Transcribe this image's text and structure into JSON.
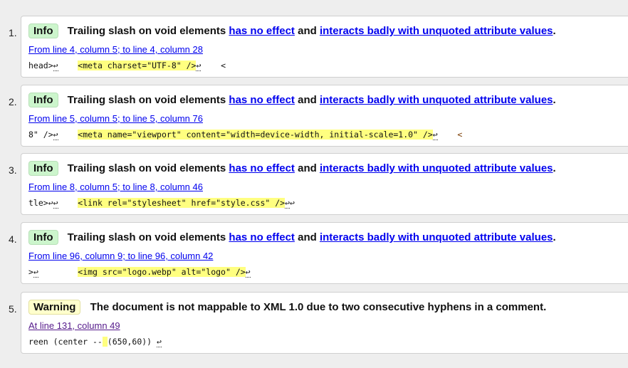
{
  "messages": [
    {
      "num": "1.",
      "type": "Info",
      "msg": "Trailing slash on void elements",
      "link1": "has no effect",
      "and": "and",
      "link2": "interacts badly with unquoted attribute values",
      "end": ".",
      "location": "From line 4, column 5; to line 4, column 28",
      "pre": "head>",
      "hl": "<meta charset=\"UTF-8\" />",
      "post": "    <"
    },
    {
      "num": "2.",
      "type": "Info",
      "msg": "Trailing slash on void elements",
      "link1": "has no effect",
      "and": "and",
      "link2": "interacts badly with unquoted attribute values",
      "end": ".",
      "location": "From line 5, column 5; to line 5, column 76",
      "pre": "8\" />",
      "hl": "<meta name=\"viewport\" content=\"width=device-width, initial-scale=1.0\" />",
      "post": "    <"
    },
    {
      "num": "3.",
      "type": "Info",
      "msg": "Trailing slash on void elements",
      "link1": "has no effect",
      "and": "and",
      "link2": "interacts badly with unquoted attribute values",
      "end": ".",
      "location": "From line 8, column 5; to line 8, column 46",
      "pre": "tle>↩",
      "hl": "<link rel=\"stylesheet\" href=\"style.css\" />",
      "post": "↩"
    },
    {
      "num": "4.",
      "type": "Info",
      "msg": "Trailing slash on void elements",
      "link1": "has no effect",
      "and": "and",
      "link2": "interacts badly with unquoted attribute values",
      "end": ".",
      "location": "From line 96, column 9; to line 96, column 42",
      "pre": ">",
      "hl": "<img src=\"logo.webp\" alt=\"logo\" />",
      "post": ""
    },
    {
      "num": "5.",
      "type": "Warning",
      "msg": "The document is not mappable to XML 1.0 due to two consecutive hyphens in a comment.",
      "location": "At line 131, column 49",
      "pre": "reen (center --",
      "hl": " ",
      "post": "(650,60)) "
    }
  ],
  "return_glyph": "↩"
}
